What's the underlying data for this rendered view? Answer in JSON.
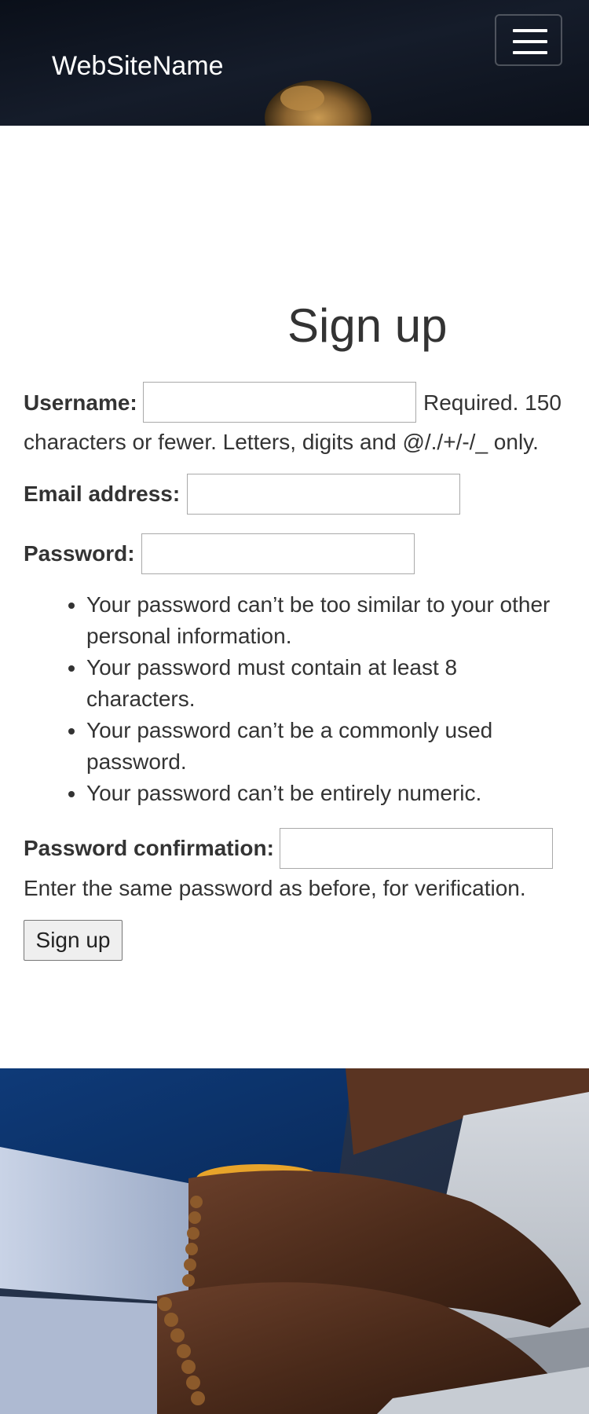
{
  "navbar": {
    "brand": "WebSiteName",
    "menu_icon": "hamburger-menu-icon"
  },
  "form": {
    "title": "Sign up",
    "username": {
      "label": "Username:",
      "value": "",
      "help_line1": "Required. 150",
      "help_line2": "characters or fewer. Letters, digits and @/./+/-/_ only."
    },
    "email": {
      "label": "Email address:",
      "value": ""
    },
    "password": {
      "label": "Password:",
      "value": "",
      "rules": [
        "Your password can’t be too similar to your other personal information.",
        "Your password must contain at least 8 characters.",
        "Your password can’t be a commonly used password.",
        "Your password can’t be entirely numeric."
      ]
    },
    "password_confirmation": {
      "label": "Password confirmation:",
      "value": "",
      "help": "Enter the same password as before, for verification."
    },
    "submit_label": "Sign up"
  },
  "colors": {
    "navbar_bg": "#0d131f",
    "text": "#333333",
    "input_border": "#a9a9a9",
    "button_bg": "#efefef"
  }
}
